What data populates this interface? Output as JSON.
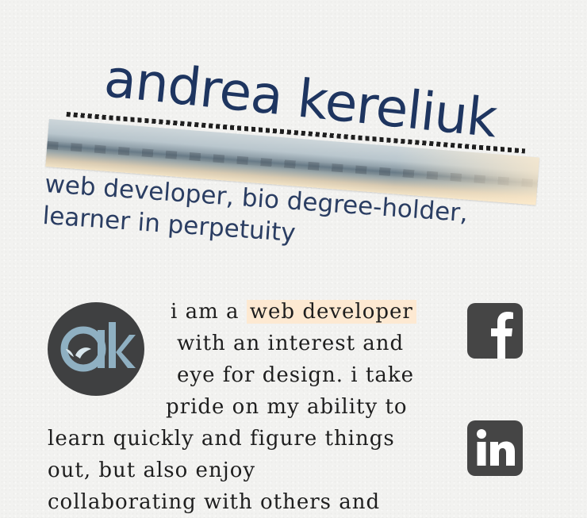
{
  "header": {
    "name": "andrea kereliuk",
    "tagline_line1": "web developer, bio degree-holder,",
    "tagline_line2": "learner in perpetuity"
  },
  "avatar": {
    "monogram": "ak",
    "icon": "ak-logo-icon",
    "colors": {
      "background": "#3f4041",
      "letters": "#8fb0c2"
    }
  },
  "bio": {
    "intro": "i am a",
    "highlight": "web developer",
    "line2": "with an interest and",
    "line3": "eye for design. i take",
    "line4": "pride on my ability to",
    "line5": "learn quickly and figure things",
    "line6": "out, but also enjoy",
    "line7": "collaborating with others and"
  },
  "social": {
    "facebook_icon": "facebook-icon",
    "linkedin_icon": "linkedin-icon",
    "color": "#454545"
  },
  "colors": {
    "name": "#1e3560",
    "tagline": "#2a3d62",
    "highlight": "#fde9d2"
  }
}
